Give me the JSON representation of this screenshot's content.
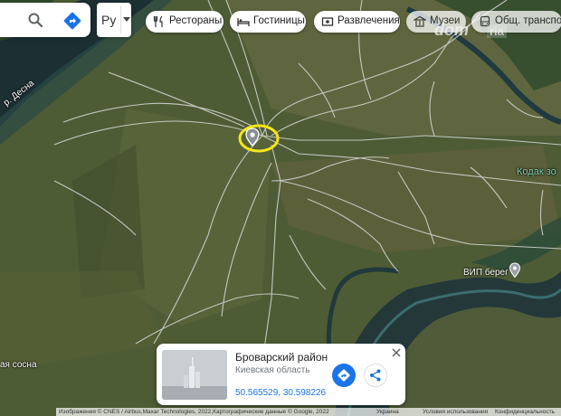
{
  "search": {
    "language_label": "Ру"
  },
  "chips": [
    {
      "label": "Рестораны",
      "icon": "fork-knife-icon"
    },
    {
      "label": "Гостиницы",
      "icon": "bed-icon"
    },
    {
      "label": "Развлечения",
      "icon": "ticket-icon"
    },
    {
      "label": "Музеи",
      "icon": "museum-icon"
    },
    {
      "label": "Общ. транспорт",
      "icon": "bus-icon"
    }
  ],
  "watermark": {
    "text_main": "dom",
    "text_badge": "ria"
  },
  "map_labels": {
    "river": "р. Десна",
    "kodak": "Кодак зо",
    "vip": "ВИП берег",
    "sosna": "ая сосна"
  },
  "place_card": {
    "title": "Броварский район",
    "subtitle": "Киевская область",
    "coordinates": "50.565529, 30.598226"
  },
  "footer": {
    "attribution": "Изображения © CNES / Airbus,Maxar Technologies, 2022,Картографические данные © Google, 2022",
    "country": "Украина",
    "terms": "Условия использования",
    "privacy": "Конфиденциальность"
  },
  "colors": {
    "accent": "#1a73e8",
    "highlight_circle": "#f5e51b",
    "road": "#d9d9d9",
    "water": "#1f3a40"
  }
}
